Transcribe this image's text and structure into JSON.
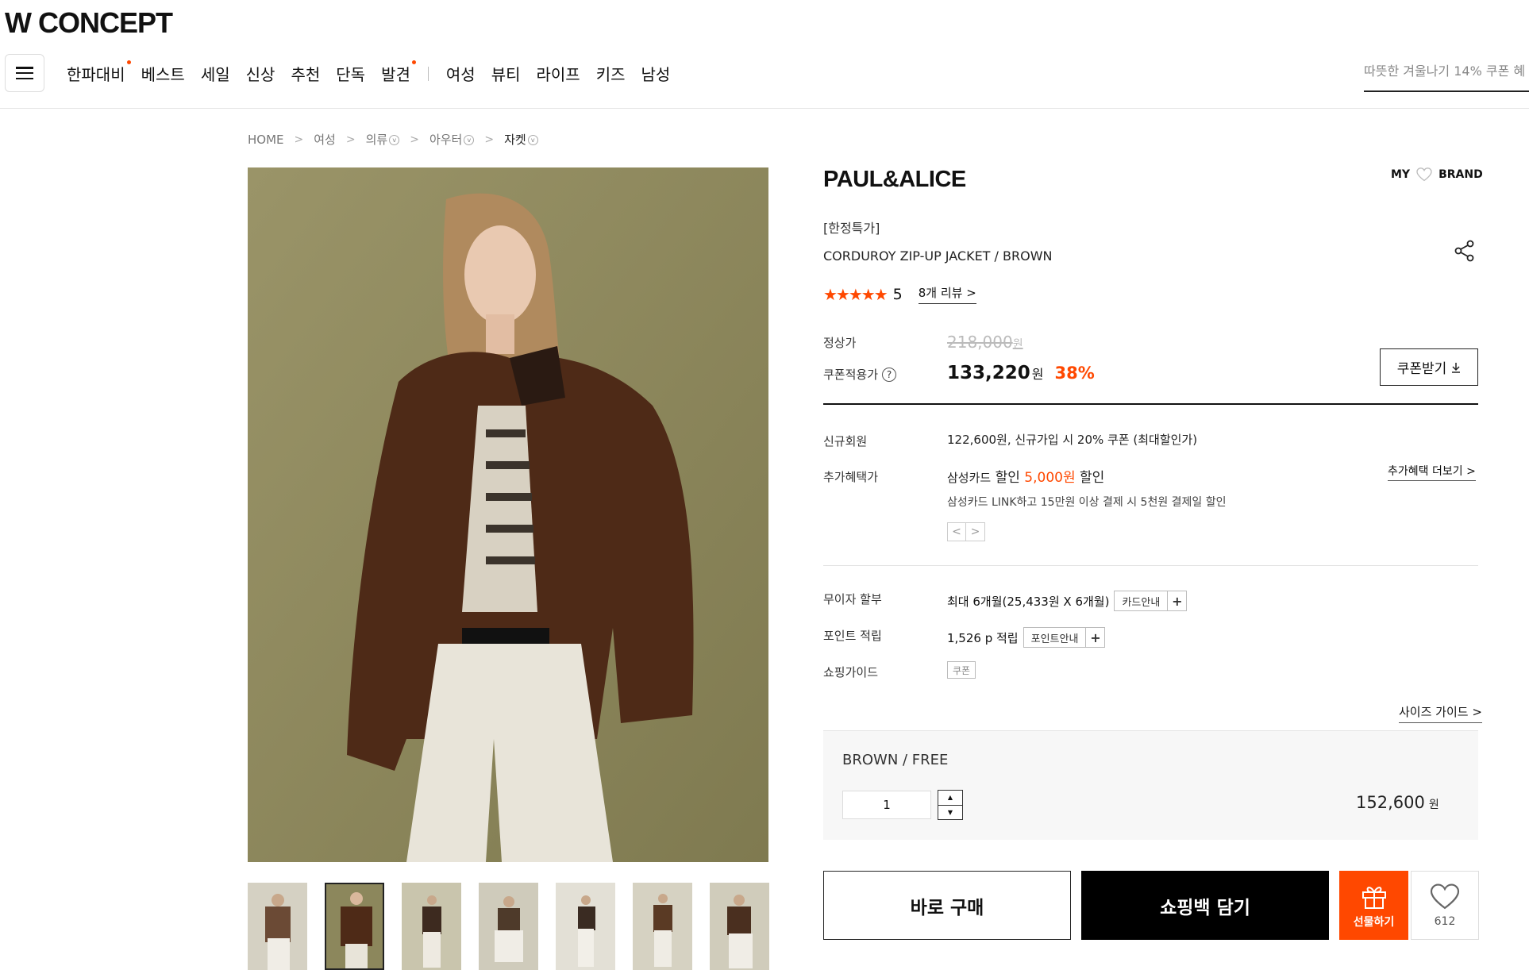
{
  "header": {
    "logo": "W CONCEPT",
    "nav": [
      {
        "label": "한파대비",
        "dot": true
      },
      {
        "label": "베스트",
        "dot": false
      },
      {
        "label": "세일",
        "dot": false
      },
      {
        "label": "신상",
        "dot": false
      },
      {
        "label": "추천",
        "dot": false
      },
      {
        "label": "단독",
        "dot": false
      },
      {
        "label": "발견",
        "dot": true
      }
    ],
    "nav_categories": [
      "여성",
      "뷰티",
      "라이프",
      "키즈",
      "남성"
    ],
    "search_placeholder": "따뜻한 겨울나기 14% 쿠폰 혜"
  },
  "breadcrumb": [
    "HOME",
    "여성",
    "의류",
    "아우터",
    "자켓"
  ],
  "product": {
    "brand": "PAUL&ALICE",
    "my_brand": {
      "my": "MY",
      "brand": "BRAND"
    },
    "label_tag": "[한정특가]",
    "name": "CORDUROY ZIP-UP JACKET / BROWN",
    "rating": {
      "stars": "★★★★★",
      "score": "5",
      "review_count": "8개 리뷰"
    },
    "pricing": {
      "original_label": "정상가",
      "original_price": "218,000",
      "won": "원",
      "coupon_label": "쿠폰적용가",
      "coupon_price": "133,220",
      "discount_rate": "38%",
      "coupon_button": "쿠폰받기"
    },
    "benefits": {
      "new_member_label": "신규회원",
      "new_member_text": "122,600원, 신규가입 시 20% 쿠폰 (최대할인가)",
      "extra_label": "추가혜택가",
      "card_name": "삼성카드",
      "discount_word": "할인",
      "card_amount": "5,000원",
      "card_sub": "삼성카드 LINK하고 15만원 이상 결제 시 5천원 결제일 할인",
      "more_link": "추가혜택 더보기"
    },
    "installment": {
      "label": "무이자 할부",
      "text": "최대 6개월(25,433원 X 6개월)",
      "guide": "카드안내"
    },
    "points": {
      "label": "포인트 적립",
      "text": "1,526 p 적립",
      "guide": "포인트안내"
    },
    "shopping_guide": {
      "label": "쇼핑가이드",
      "tag": "쿠폰"
    },
    "size_guide": "사이즈 가이드",
    "option": {
      "name": "BROWN / FREE",
      "quantity": "1",
      "price": "152,600",
      "won": "원"
    },
    "actions": {
      "buy_now": "바로 구매",
      "add_to_cart": "쇼핑백 담기",
      "gift": "선물하기",
      "like_count": "612"
    }
  },
  "colors": {
    "accent": "#ff4800",
    "dark": "#000000",
    "border": "#dddddd"
  }
}
